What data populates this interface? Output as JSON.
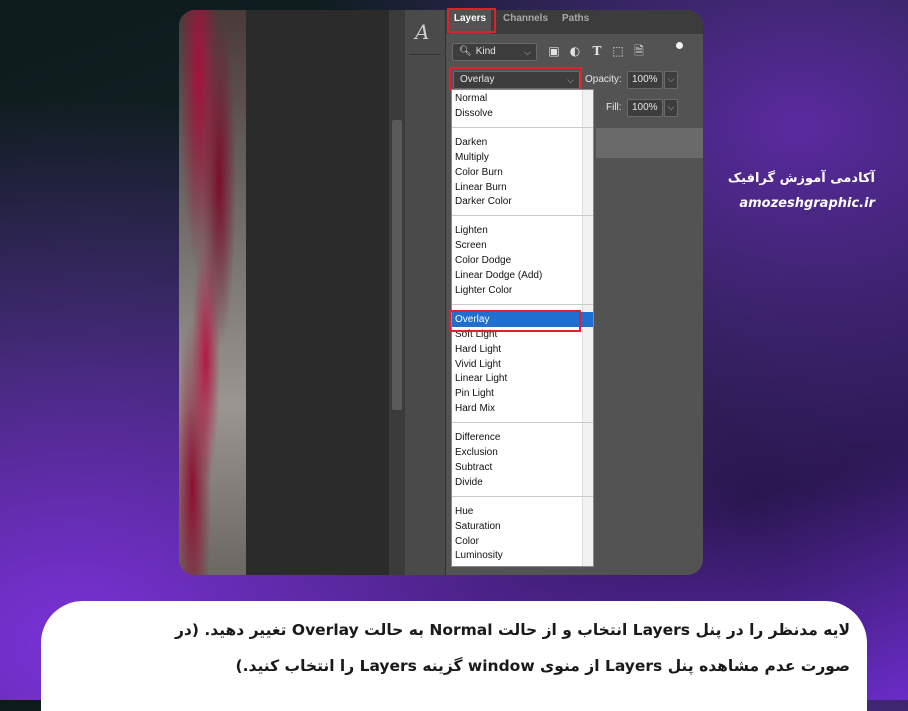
{
  "panel": {
    "tabs": [
      "Layers",
      "Channels",
      "Paths"
    ],
    "active_tab": "Layers",
    "tool_glyph": "A",
    "filter": {
      "kind_label": "Kind",
      "icons": [
        "image-filter-icon",
        "adjustment-filter-icon",
        "type-filter-icon",
        "shape-filter-icon",
        "smart-object-filter-icon",
        "filter-toggle-dot"
      ]
    },
    "blend_mode": "Overlay",
    "opacity_label": "Opacity:",
    "opacity_value": "100%",
    "fill_label": "Fill:",
    "fill_value": "100%"
  },
  "dropdown": {
    "selected": "Overlay",
    "groups": [
      [
        "Normal",
        "Dissolve"
      ],
      [
        "Darken",
        "Multiply",
        "Color Burn",
        "Linear Burn",
        "Darker Color"
      ],
      [
        "Lighten",
        "Screen",
        "Color Dodge",
        "Linear Dodge (Add)",
        "Lighter Color"
      ],
      [
        "Overlay",
        "Soft Light",
        "Hard Light",
        "Vivid Light",
        "Linear Light",
        "Pin Light",
        "Hard Mix"
      ],
      [
        "Difference",
        "Exclusion",
        "Subtract",
        "Divide"
      ],
      [
        "Hue",
        "Saturation",
        "Color",
        "Luminosity"
      ]
    ]
  },
  "brand": {
    "name_fa": "آکادمی آموزش گرافیک",
    "url": "amozeshgraphic.ir"
  },
  "caption": {
    "line1": "لایه مدنظر را در پنل Layers انتخاب و از حالت Normal به حالت Overlay تغییر دهید. (در",
    "line2": "صورت عدم مشاهده پنل Layers از منوی window گزینه Layers را انتخاب کنید.)"
  },
  "colors": {
    "highlight_border": "#e0202a",
    "selection": "#1f6fd1",
    "panel_bg": "#535353"
  }
}
